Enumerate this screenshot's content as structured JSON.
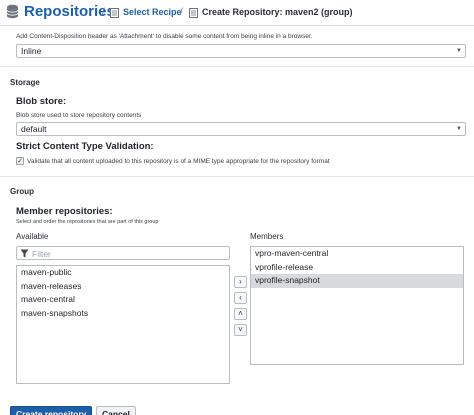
{
  "header": {
    "title": "Repositories",
    "crumbs": [
      {
        "label": "Select Recipe"
      },
      {
        "label": "Create Repository: maven2 (group)"
      }
    ],
    "separator": "/"
  },
  "content_disposition": {
    "help": "Add Content-Disposition header as 'Attachment' to disable some content from being inline in a browser.",
    "value": "Inline"
  },
  "storage": {
    "section_title": "Storage",
    "blob_store_label": "Blob store:",
    "blob_store_help": "Blob store used to store repository contents",
    "blob_store_value": "default",
    "strict_label": "Strict Content Type Validation:",
    "strict_checked": true,
    "strict_help": "Validate that all content uploaded to this repository is of a MIME type appropriate for the repository format"
  },
  "group": {
    "section_title": "Group",
    "members_label": "Member repositories:",
    "members_help": "Select and order the repositories that are part of this group",
    "available_label": "Available",
    "filter_placeholder": "Filter",
    "available_items": [
      "maven-public",
      "maven-releases",
      "maven-central",
      "maven-snapshots"
    ],
    "members_label_col": "Members",
    "member_items": [
      "vpro-maven-central",
      "vprofile-release",
      "vprofile-snapshot"
    ],
    "selected_member_index": 2
  },
  "buttons": {
    "create": "Create repository",
    "cancel": "Cancel"
  },
  "colors": {
    "brand": "#1d5fa8",
    "selected_row": "#d6d9dd"
  }
}
